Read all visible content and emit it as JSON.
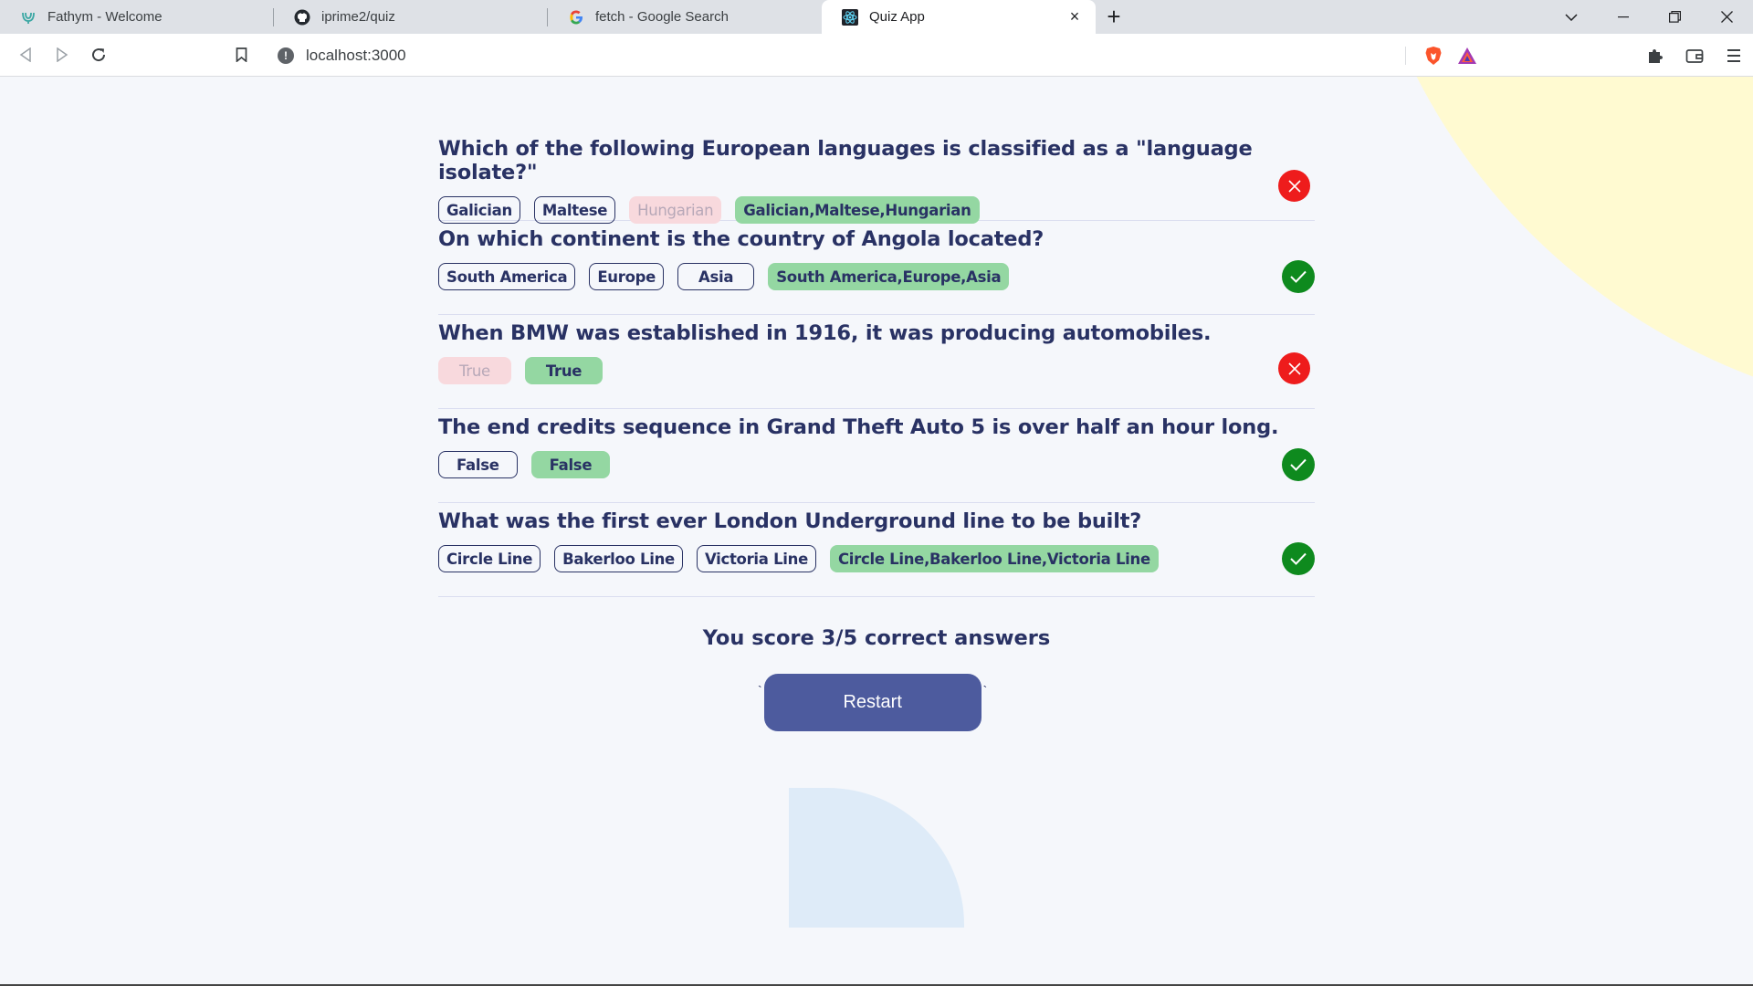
{
  "browser": {
    "tabs": [
      {
        "title": "Fathym - Welcome",
        "icon": "fathym-logo-icon",
        "active": false
      },
      {
        "title": "iprime2/quiz",
        "icon": "github-icon",
        "active": false
      },
      {
        "title": "fetch - Google Search",
        "icon": "google-icon",
        "active": false
      },
      {
        "title": "Quiz App",
        "icon": "react-icon",
        "active": true
      }
    ],
    "url": "localhost:3000"
  },
  "quiz": {
    "questions": [
      {
        "text": "Which of the following European languages is classified as a \"language isolate?\"",
        "answers": [
          "Galician",
          "Maltese",
          "Hungarian",
          "Galician,Maltese,Hungarian"
        ],
        "states": [
          "neutral",
          "neutral",
          "wrong",
          "correct"
        ],
        "result": "incorrect"
      },
      {
        "text": "On which continent is the country of Angola located?",
        "answers": [
          "South America",
          "Europe",
          "Asia",
          "South America,Europe,Asia"
        ],
        "states": [
          "neutral",
          "neutral",
          "neutral",
          "correct"
        ],
        "result": "correct"
      },
      {
        "text": "When BMW was established in 1916, it was producing automobiles.",
        "answers": [
          "True",
          "True"
        ],
        "states": [
          "wrong",
          "correct"
        ],
        "result": "incorrect"
      },
      {
        "text": "The end credits sequence in Grand Theft Auto 5 is over half an hour long.",
        "answers": [
          "False",
          "False"
        ],
        "states": [
          "neutral",
          "correct"
        ],
        "result": "correct"
      },
      {
        "text": "What was the first ever London Underground line to be built?",
        "answers": [
          "Circle Line",
          "Bakerloo Line",
          "Victoria Line",
          "Circle Line,Bakerloo Line,Victoria Line"
        ],
        "states": [
          "neutral",
          "neutral",
          "neutral",
          "correct"
        ],
        "result": "correct"
      }
    ],
    "score_text": "You score 3/5 correct answers",
    "restart_label": "Restart",
    "backtick": "`"
  },
  "colors": {
    "primary": "#293264",
    "button": "#4d5b9e",
    "correct": "#94d7a2",
    "wrong": "#f8d9dd",
    "good_mark": "#0e8a1e",
    "bad_mark": "#ee1c1c"
  }
}
